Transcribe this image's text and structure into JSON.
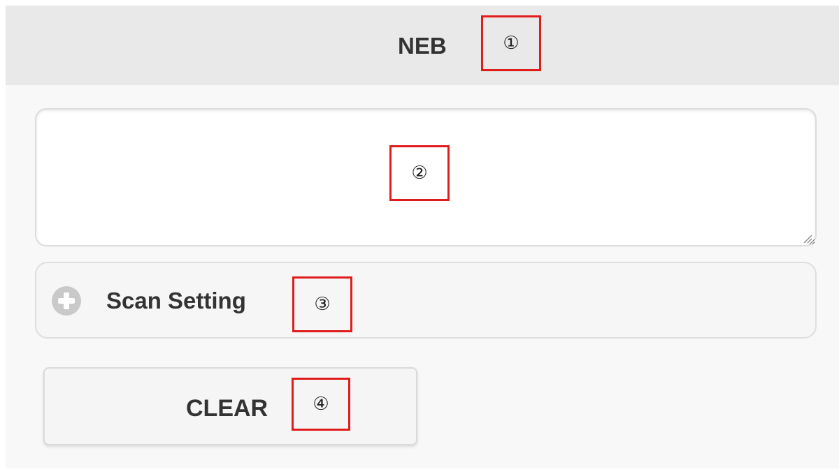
{
  "header": {
    "title": "NEB"
  },
  "text_area": {
    "value": "",
    "placeholder": ""
  },
  "scan_setting": {
    "label": "Scan Setting",
    "icon": "plus-circle-icon",
    "expanded": false
  },
  "clear_button": {
    "label": "CLEAR"
  },
  "callouts": [
    "①",
    "②",
    "③",
    "④"
  ],
  "colors": {
    "header_bg": "#e9e9e9",
    "callout_border": "#e01c1c",
    "text": "#333333",
    "icon": "#c9c9c9"
  }
}
